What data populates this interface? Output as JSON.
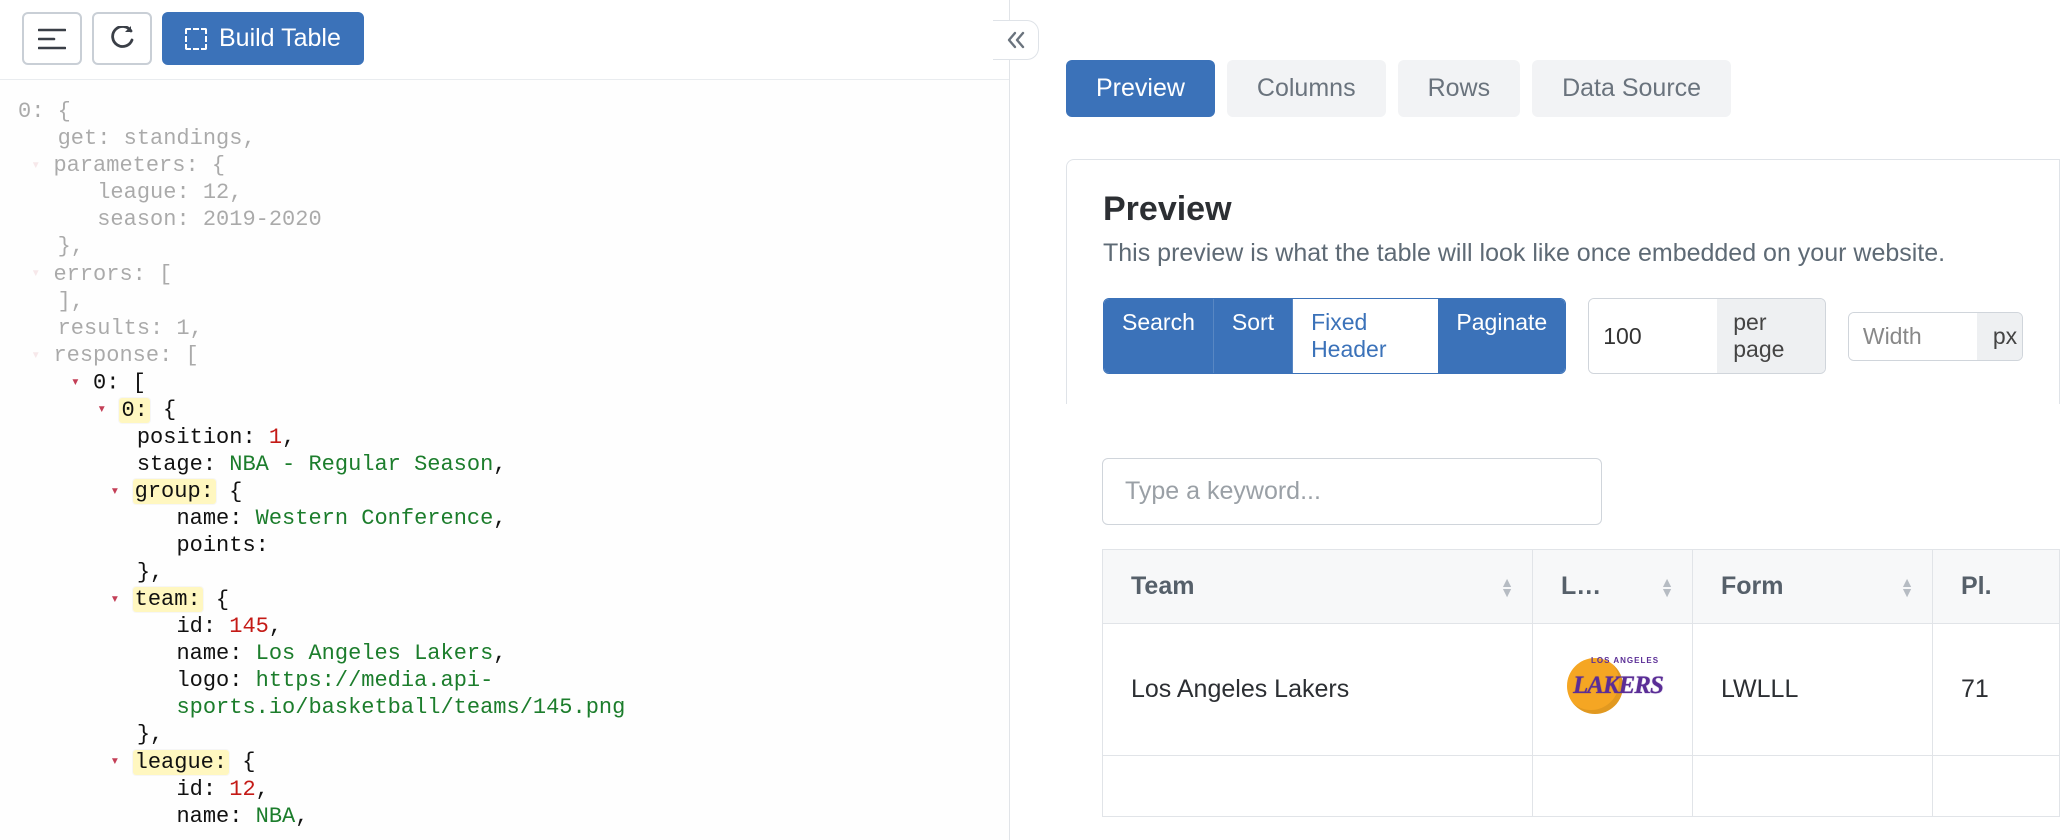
{
  "toolbar": {
    "build_label": "Build Table"
  },
  "code": {
    "lines_faded": [
      "0: {",
      "   get: standings,",
      "   parameters: {",
      "      league: 12,",
      "      season: 2019-2020",
      "   },",
      "   errors: [",
      "   ],",
      "   results: 1,",
      "   response: ["
    ],
    "collapse_mark_0": "0:",
    "collapse_mark_1": "0:",
    "position_key": "position:",
    "position_val": "1",
    "stage_key": "stage:",
    "stage_val": "NBA - Regular Season",
    "group_key": "group:",
    "group_name_key": "name:",
    "group_name_val": "Western Conference",
    "group_points_key": "points:",
    "team_key": "team:",
    "team_id_key": "id:",
    "team_id_val": "145",
    "team_name_key": "name:",
    "team_name_val": "Los Angeles Lakers",
    "team_logo_key": "logo:",
    "team_logo_val1": "https://media.api-",
    "team_logo_val2": "sports.io/basketball/teams/145.png",
    "league_key": "league:",
    "league_id_key": "id:",
    "league_id_val": "12",
    "league_name_key": "name:",
    "league_name_val": "NBA"
  },
  "tabs": {
    "preview": "Preview",
    "columns": "Columns",
    "rows": "Rows",
    "data_source": "Data Source"
  },
  "preview": {
    "title": "Preview",
    "description": "This preview is what the table will look like once embedded on your website.",
    "toggles": {
      "search": "Search",
      "sort": "Sort",
      "fixed_header": "Fixed Header",
      "paginate": "Paginate"
    },
    "per_page_value": "100",
    "per_page_label": "per page",
    "width_placeholder": "Width",
    "width_unit": "px",
    "search_placeholder": "Type a keyword..."
  },
  "table": {
    "headers": {
      "team": "Team",
      "logo": "L…",
      "form": "Form",
      "plays": "Pl."
    },
    "row1": {
      "team": "Los Angeles Lakers",
      "form": "LWLLL",
      "plays": "71"
    }
  }
}
